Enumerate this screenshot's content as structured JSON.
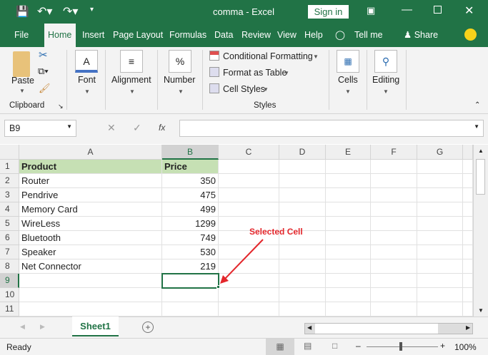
{
  "window": {
    "title": "comma  -  Excel",
    "sign_in": "Sign in"
  },
  "tabs": [
    "File",
    "Home",
    "Insert",
    "Page Layout",
    "Formulas",
    "Data",
    "Review",
    "View",
    "Help",
    "Tell me",
    "Share"
  ],
  "ribbon": {
    "paste": "Paste",
    "clipboard": "Clipboard",
    "font": "Font",
    "alignment": "Alignment",
    "number": "Number",
    "number_glyph": "%",
    "conditional": "Conditional Formatting",
    "format_table": "Format as Table",
    "cell_styles": "Cell Styles",
    "styles": "Styles",
    "cells": "Cells",
    "editing": "Editing"
  },
  "formula_bar": {
    "name_box": "B9",
    "fx": "fx",
    "value": ""
  },
  "columns": [
    "A",
    "B",
    "C",
    "D",
    "E",
    "F",
    "G"
  ],
  "rows": [
    "1",
    "2",
    "3",
    "4",
    "5",
    "6",
    "7",
    "8",
    "9",
    "10",
    "11"
  ],
  "table": {
    "headers": [
      "Product",
      "Price"
    ],
    "data": [
      [
        "Router",
        "350"
      ],
      [
        "Pendrive",
        "475"
      ],
      [
        "Memory Card",
        "499"
      ],
      [
        "WireLess",
        "1299"
      ],
      [
        "Bluetooth",
        "749"
      ],
      [
        "Speaker",
        "530"
      ],
      [
        "Net Connector",
        "219"
      ]
    ]
  },
  "annotation": {
    "text": "Selected Cell",
    "color": "#e3262b"
  },
  "sheet_tab": "Sheet1",
  "status": {
    "ready": "Ready",
    "zoom": "100%"
  },
  "colors": {
    "brand": "#217346",
    "header_fill": "#c6e0b4"
  }
}
